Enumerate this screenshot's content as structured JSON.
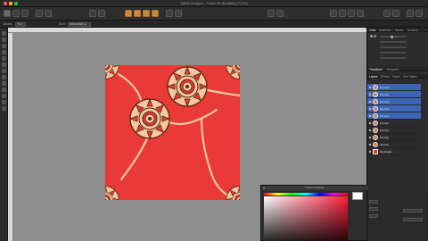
{
  "window": {
    "title": "Affinity Designer – Flower tile (Modified) (72.3%)"
  },
  "context": {
    "zoom_label": "Zoom:",
    "zoom_value": "72.3",
    "doc_label": "Size:",
    "doc_value": "2000×2000 px"
  },
  "panel": {
    "top_tabs": [
      "Color",
      "Swatches",
      "Stroke",
      "Brushes"
    ],
    "mid_tabs": [
      "Transform",
      "Navigator"
    ],
    "layer_tabs": [
      "Layers",
      "Effects",
      "Styles",
      "Text Styles"
    ]
  },
  "layers": [
    {
      "name": "(Curve)",
      "selected": true
    },
    {
      "name": "(Curve)",
      "selected": true
    },
    {
      "name": "(Curve)",
      "selected": true
    },
    {
      "name": "(Curve)",
      "selected": true
    },
    {
      "name": "(Curve)",
      "selected": true
    },
    {
      "name": "(Curve)",
      "selected": false
    },
    {
      "name": "(Curve)",
      "selected": false
    },
    {
      "name": "(Curve)",
      "selected": false
    },
    {
      "name": "(Curve)",
      "selected": false
    },
    {
      "name": "Rectangle",
      "selected": false
    }
  ],
  "color_picker": {
    "title": "Colour Chooser",
    "selected_hex": "#ffffff",
    "hue_hex": "#ff1f3a"
  },
  "colors": {
    "artboard": "#e93a37",
    "flower_petal": "#f2c9a0",
    "flower_outline": "#5a2210",
    "selection_blue": "#3d66b8"
  }
}
